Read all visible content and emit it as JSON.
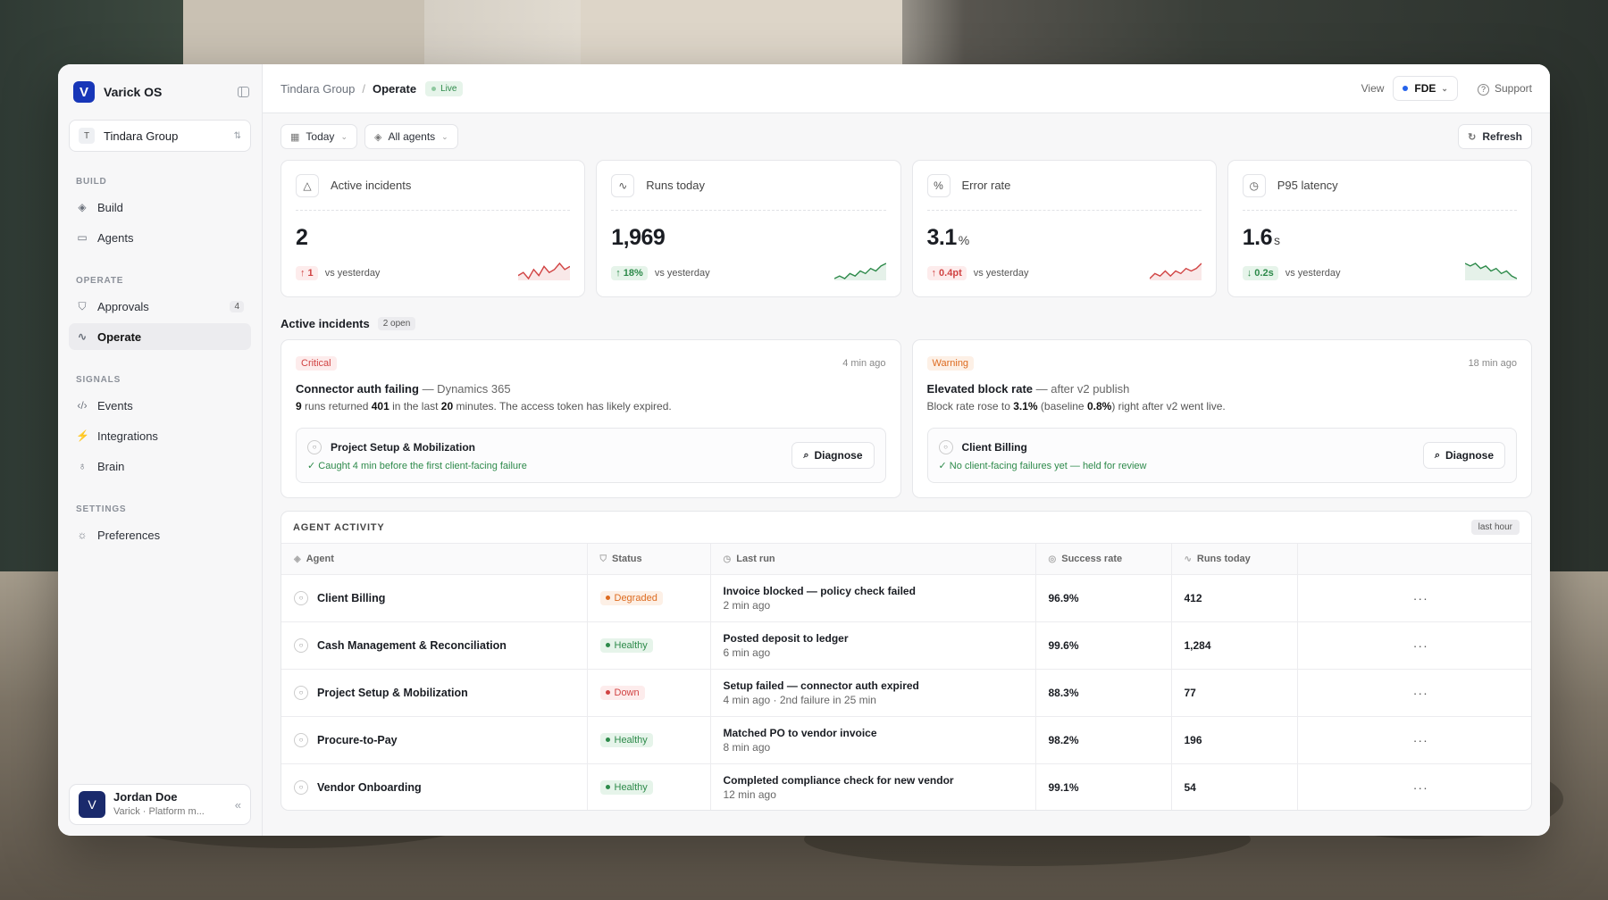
{
  "app": {
    "name": "Varick OS",
    "logo_letter": "V"
  },
  "workspace": {
    "badge": "T",
    "name": "Tindara Group"
  },
  "sidebar": {
    "sections": [
      {
        "label": "BUILD",
        "items": [
          {
            "label": "Build",
            "icon": "layers-icon"
          },
          {
            "label": "Agents",
            "icon": "briefcase-icon"
          }
        ]
      },
      {
        "label": "OPERATE",
        "items": [
          {
            "label": "Approvals",
            "icon": "shield-check-icon",
            "count": "4"
          },
          {
            "label": "Operate",
            "icon": "activity-icon",
            "active": true
          }
        ]
      },
      {
        "label": "SIGNALS",
        "items": [
          {
            "label": "Events",
            "icon": "code-icon"
          },
          {
            "label": "Integrations",
            "icon": "plug-icon"
          },
          {
            "label": "Brain",
            "icon": "lightbulb-icon"
          }
        ]
      },
      {
        "label": "SETTINGS",
        "items": [
          {
            "label": "Preferences",
            "icon": "sun-icon"
          }
        ]
      }
    ]
  },
  "user": {
    "initial": "V",
    "name": "Jordan Doe",
    "subtitle": "Varick · Platform m..."
  },
  "topbar": {
    "crumb1": "Tindara Group",
    "sep": "/",
    "crumb2": "Operate",
    "live": "Live",
    "view_label": "View",
    "view_value": "FDE",
    "support": "Support"
  },
  "filters": {
    "date": "Today",
    "agents": "All agents",
    "refresh": "Refresh"
  },
  "kpis": [
    {
      "title": "Active incidents",
      "icon": "alert-triangle-icon",
      "value": "2",
      "unit": "",
      "delta": "↑ 1",
      "delta_tone": "bad",
      "compare": "vs yesterday",
      "spark": [
        3,
        4,
        2,
        5,
        3,
        6,
        4,
        5,
        7,
        5,
        6
      ],
      "spark_color": "#d14343"
    },
    {
      "title": "Runs today",
      "icon": "pulse-icon",
      "value": "1,969",
      "unit": "",
      "delta": "↑ 18%",
      "delta_tone": "good",
      "compare": "vs yesterday",
      "spark": [
        2,
        3,
        2,
        4,
        3,
        5,
        4,
        6,
        5,
        7,
        8
      ],
      "spark_color": "#2d8a4a"
    },
    {
      "title": "Error rate",
      "icon": "percent-icon",
      "value": "3.1",
      "unit": "%",
      "delta": "↑ 0.4pt",
      "delta_tone": "bad",
      "compare": "vs yesterday",
      "spark": [
        2,
        4,
        3,
        5,
        3,
        5,
        4,
        6,
        5,
        6,
        8
      ],
      "spark_color": "#d14343"
    },
    {
      "title": "P95 latency",
      "icon": "clock-icon",
      "value": "1.6",
      "unit": "s",
      "delta": "↓ 0.2s",
      "delta_tone": "good",
      "compare": "vs yesterday",
      "spark": [
        7,
        6,
        7,
        5,
        6,
        4,
        5,
        3,
        4,
        2,
        1
      ],
      "spark_color": "#2d8a4a"
    }
  ],
  "incidents_section": {
    "title": "Active incidents",
    "badge": "2 open"
  },
  "incidents": [
    {
      "severity": "Critical",
      "sev_class": "crit",
      "ago": "4 min ago",
      "title": "Connector auth failing",
      "title_sub": " — Dynamics 365",
      "desc_parts": [
        "9",
        " runs returned ",
        "401",
        " in the last ",
        "20",
        " minutes. The access token has likely expired."
      ],
      "agent": "Project Setup & Mobilization",
      "note": "✓ Caught 4 min before the first client-facing failure",
      "action": "Diagnose"
    },
    {
      "severity": "Warning",
      "sev_class": "warn",
      "ago": "18 min ago",
      "title": "Elevated block rate",
      "title_sub": " — after v2 publish",
      "desc_parts": [
        "Block rate rose to ",
        "3.1%",
        " (baseline ",
        "0.8%",
        ") right after v2 went live.",
        ""
      ],
      "agent": "Client Billing",
      "note": "✓ No client-facing failures yet — held for review",
      "action": "Diagnose"
    }
  ],
  "activity": {
    "title": "AGENT ACTIVITY",
    "range": "last hour",
    "columns": [
      "Agent",
      "Status",
      "Last run",
      "Success rate",
      "Runs today"
    ],
    "rows": [
      {
        "agent": "Client Billing",
        "status": "Degraded",
        "last_run": "Invoice blocked — policy check failed",
        "last_when": "2 min ago",
        "success": "96.9%",
        "runs": "412"
      },
      {
        "agent": "Cash Management & Reconciliation",
        "status": "Healthy",
        "last_run": "Posted deposit to ledger",
        "last_when": "6 min ago",
        "success": "99.6%",
        "runs": "1,284"
      },
      {
        "agent": "Project Setup & Mobilization",
        "status": "Down",
        "last_run": "Setup failed — connector auth expired",
        "last_when": "4 min ago · 2nd failure in 25 min",
        "success": "88.3%",
        "runs": "77"
      },
      {
        "agent": "Procure-to-Pay",
        "status": "Healthy",
        "last_run": "Matched PO to vendor invoice",
        "last_when": "8 min ago",
        "success": "98.2%",
        "runs": "196"
      },
      {
        "agent": "Vendor Onboarding",
        "status": "Healthy",
        "last_run": "Completed compliance check for new vendor",
        "last_when": "12 min ago",
        "success": "99.1%",
        "runs": "54"
      }
    ]
  }
}
